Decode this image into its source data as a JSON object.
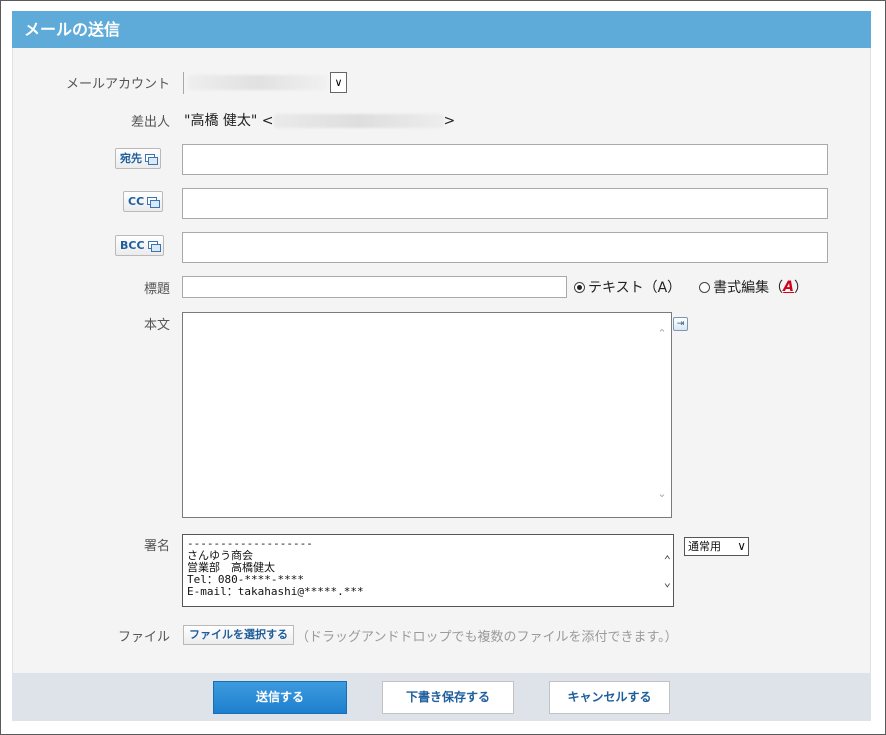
{
  "window": {
    "title": "メールの送信"
  },
  "form": {
    "account_label": "メールアカウント",
    "account_value": "",
    "from_label": "差出人",
    "from_name": "\"高橋 健太\" <",
    "from_suffix": ">",
    "to_button": "宛先",
    "cc_button": "CC",
    "bcc_button": "BCC",
    "to_value": "",
    "cc_value": "",
    "bcc_value": "",
    "subject_label": "標題",
    "subject_value": "",
    "format_text": "テキスト（A）",
    "format_rich_prefix": "書式編集（",
    "format_rich_letter": "A",
    "format_rich_suffix": "）",
    "format_selected": "text",
    "body_label": "本文",
    "body_value": "",
    "signature_label": "署名",
    "signature_lines": [
      "-------------------",
      "さんゆう商会",
      "営業部　高橋健太",
      "Tel：080-****-****",
      "E-mail：takahashi@*****.***"
    ],
    "signature_select": "通常用",
    "file_label": "ファイル",
    "file_button": "ファイルを選択する",
    "file_hint": "（ドラッグアンドドロップでも複数のファイルを添付できます。）"
  },
  "footer": {
    "send": "送信する",
    "save_draft": "下書き保存する",
    "cancel": "キャンセルする"
  },
  "colors": {
    "title_bar": "#5eaad8",
    "primary_button": "#1e7fcf",
    "footer_bg": "#dde3e8"
  }
}
